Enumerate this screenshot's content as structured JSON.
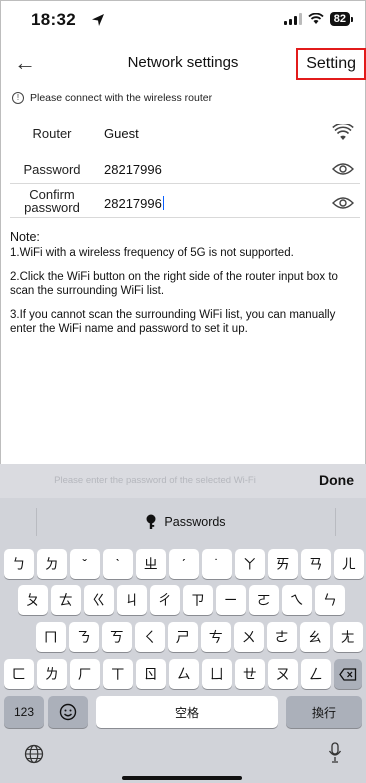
{
  "status": {
    "time": "18:32",
    "battery": "82"
  },
  "nav": {
    "back": "←",
    "title": "Network settings",
    "setting": "Setting"
  },
  "notice": "Please connect with the wireless router",
  "form": {
    "router_label": "Router",
    "router_value": "Guest",
    "password_label": "Password",
    "password_value": "28217996",
    "confirm_label_1": "Confirm",
    "confirm_label_2": "password",
    "confirm_value": "28217996"
  },
  "note": {
    "title": "Note:",
    "items": [
      "1.WiFi with a wireless frequency of 5G is not supported.",
      "2.Click the WiFi button on the right side of the router input box to scan the surrounding WiFi list.",
      "3.If you cannot scan the surrounding WiFi list, you can manually enter the WiFi name and password to set it up."
    ]
  },
  "keyboard": {
    "hint": "Please enter the password of the selected Wi-Fi",
    "done": "Done",
    "passwords": "Passwords",
    "row1": [
      "ㄅ",
      "ㄉ",
      "ˇ",
      "ˋ",
      "ㄓ",
      "ˊ",
      "˙",
      "ㄚ",
      "ㄞ",
      "ㄢ",
      "ㄦ"
    ],
    "row2": [
      "ㄆ",
      "ㄊ",
      "ㄍ",
      "ㄐ",
      "ㄔ",
      "ㄗ",
      "ㄧ",
      "ㄛ",
      "ㄟ",
      "ㄣ"
    ],
    "row3": [
      "ㄇ",
      "ㄋ",
      "ㄎ",
      "ㄑ",
      "ㄕ",
      "ㄘ",
      "ㄨ",
      "ㄜ",
      "ㄠ",
      "ㄤ"
    ],
    "row4": [
      "ㄈ",
      "ㄌ",
      "ㄏ",
      "ㄒ",
      "ㄖ",
      "ㄙ",
      "ㄩ",
      "ㄝ",
      "ㄡ",
      "ㄥ"
    ],
    "num": "123",
    "space": "空格",
    "return": "換行"
  }
}
